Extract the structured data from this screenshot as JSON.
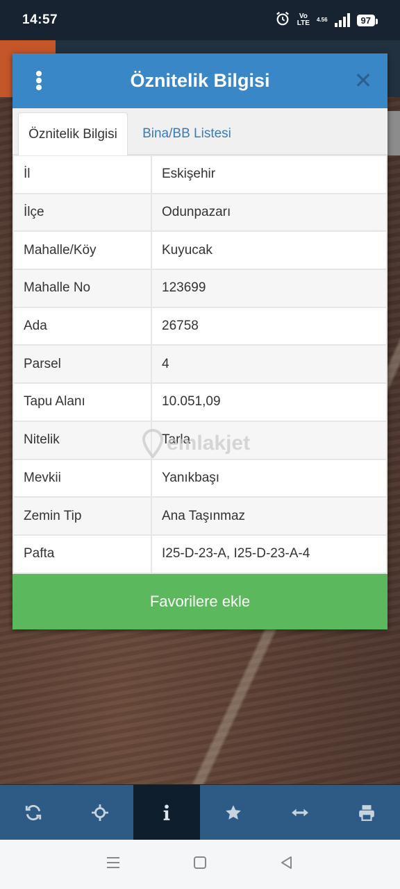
{
  "status_bar": {
    "time": "14:57",
    "volte_top": "Vo",
    "volte_bottom": "LTE",
    "net_speed": "4.56",
    "battery": "97",
    "icons": [
      "alarm-icon",
      "volte-icon",
      "signal-icon",
      "battery-icon"
    ]
  },
  "modal": {
    "title": "Öznitelik Bilgisi",
    "menu_icon": "more-vertical-icon",
    "close_icon": "close-icon",
    "tabs": [
      {
        "label": "Öznitelik Bilgisi",
        "active": true
      },
      {
        "label": "Bina/BB Listesi",
        "active": false
      }
    ],
    "rows": [
      {
        "key": "İl",
        "value": "Eskişehir"
      },
      {
        "key": "İlçe",
        "value": "Odunpazarı"
      },
      {
        "key": "Mahalle/Köy",
        "value": "Kuyucak"
      },
      {
        "key": "Mahalle No",
        "value": "123699"
      },
      {
        "key": "Ada",
        "value": "26758"
      },
      {
        "key": "Parsel",
        "value": "4"
      },
      {
        "key": "Tapu Alanı",
        "value": "10.051,09"
      },
      {
        "key": "Nitelik",
        "value": "Tarla"
      },
      {
        "key": "Mevkii",
        "value": "Yanıkbaşı"
      },
      {
        "key": "Zemin Tip",
        "value": "Ana Taşınmaz"
      },
      {
        "key": "Pafta",
        "value": "I25-D-23-A, I25-D-23-A-4"
      }
    ],
    "favorite_button": "Favorilere ekle"
  },
  "watermark": "emlakjet",
  "toolbar": {
    "items": [
      {
        "icon": "refresh-icon",
        "active": false
      },
      {
        "icon": "crosshair-icon",
        "active": false
      },
      {
        "icon": "info-icon",
        "active": true
      },
      {
        "icon": "star-icon",
        "active": false
      },
      {
        "icon": "measure-arrows-icon",
        "active": false
      },
      {
        "icon": "print-icon",
        "active": false
      }
    ]
  },
  "system_nav": [
    "menu-icon",
    "home-icon",
    "back-icon"
  ],
  "colors": {
    "header_blue": "#3a87c8",
    "tab_link": "#3a7ab8",
    "favorite_green": "#5cb85c",
    "toolbar_blue": "#2e5b86",
    "toolbar_active": "#0f1e2c"
  }
}
